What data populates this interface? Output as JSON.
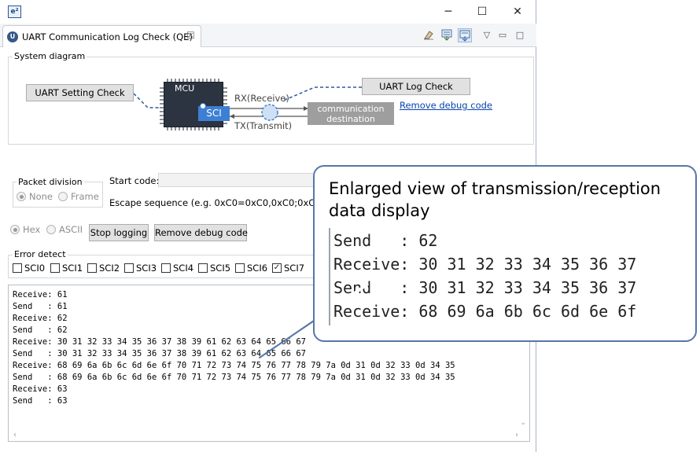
{
  "window": {
    "app_icon": "e²",
    "controls": {
      "minimize": "─",
      "maximize": "☐",
      "close": "✕"
    }
  },
  "tab": {
    "icon": "uart-icon",
    "title": "UART Communication Log Check (QE)",
    "close": "☒"
  },
  "toolbar": {
    "icons": [
      "clear-icon",
      "export-icon",
      "scroll-lock-icon",
      "view-menu-icon",
      "minimize-view-icon",
      "maximize-view-icon"
    ]
  },
  "system_diagram": {
    "title": "System diagram",
    "uart_setting_check": "UART Setting Check",
    "mcu": "MCU",
    "sci": "SCI",
    "rx": "RX(Receive)",
    "tx": "TX(Transmit)",
    "destination_line1": "communication",
    "destination_line2": "destination",
    "uart_log_check": "UART Log Check",
    "remove_debug_code_link": "Remove debug code"
  },
  "packet_division": {
    "title": "Packet division",
    "none": "None",
    "frame": "Frame",
    "start_code_label": "Start code:",
    "escape_label": "Escape sequence (e.g. 0xC0=0xC0,0xC0;0xC1=0xC0"
  },
  "format": {
    "hex": "Hex",
    "ascii": "ASCII"
  },
  "buttons": {
    "stop_logging": "Stop logging",
    "remove_debug_code": "Remove debug code"
  },
  "error_detect": {
    "title": "Error detect",
    "channels": [
      "SCI0",
      "SCI1",
      "SCI2",
      "SCI3",
      "SCI4",
      "SCI5",
      "SCI6",
      "SCI7"
    ],
    "checked": [
      "SCI7"
    ]
  },
  "log": {
    "lines": [
      "Receive: 61",
      "Send   : 61",
      "Receive: 62",
      "Send   : 62",
      "Receive: 30 31 32 33 34 35 36 37 38 39 61 62 63 64 65 66 67",
      "Send   : 30 31 32 33 34 35 36 37 38 39 61 62 63 64 65 66 67",
      "Receive: 68 69 6a 6b 6c 6d 6e 6f 70 71 72 73 74 75 76 77 78 79 7a 0d 31 0d 32 33 0d 34 35",
      "Send   : 68 69 6a 6b 6c 6d 6e 6f 70 71 72 73 74 75 76 77 78 79 7a 0d 31 0d 32 33 0d 34 35",
      "Receive: 63",
      "Send   : 63"
    ]
  },
  "callout": {
    "title": "Enlarged view of transmission/reception data display",
    "lines": [
      "Send   : 62",
      "Receive: 30 31 32 33 34 35 36 37",
      "Send   : 30 31 32 33 34 35 36 37",
      "Receive: 68 69 6a 6b 6c 6d 6e 6f"
    ]
  },
  "colors": {
    "accent": "#3d7fd3",
    "link": "#0645ad",
    "callout_border": "#5677a8"
  }
}
